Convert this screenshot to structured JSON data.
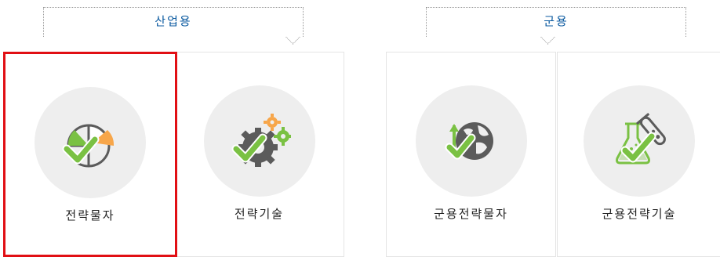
{
  "groups": [
    {
      "label": "산업용",
      "cards": [
        {
          "label": "전략물자",
          "icon": "pie-chart-check-icon",
          "selected": true
        },
        {
          "label": "전략기술",
          "icon": "gears-check-icon",
          "selected": false
        }
      ]
    },
    {
      "label": "군용",
      "cards": [
        {
          "label": "군용전략물자",
          "icon": "globe-check-icon",
          "selected": false
        },
        {
          "label": "군용전략기술",
          "icon": "flask-check-icon",
          "selected": false
        }
      ]
    }
  ],
  "colors": {
    "group_label": "#0b5aa0",
    "check_green": "#7ac143",
    "accent_orange": "#f7a64a",
    "icon_gray": "#5b5b5b",
    "selected_border": "#e10f14",
    "circle_bg": "#eeeeee"
  }
}
